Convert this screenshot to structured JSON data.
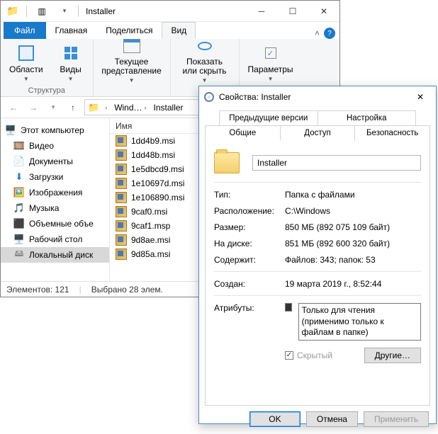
{
  "explorer": {
    "title": "Installer",
    "filetab": "Файл",
    "tabs": [
      "Главная",
      "Поделиться",
      "Вид"
    ],
    "active_tab": 2,
    "ribbon": {
      "areas": "Области",
      "views": "Виды",
      "current_view": "Текущее представление",
      "show_hide": "Показать или скрыть",
      "params": "Параметры",
      "group_structure": "Структура"
    },
    "breadcrumb": [
      "Wind…",
      "Installer"
    ],
    "sidebar": [
      {
        "label": "Этот компьютер",
        "icon": "pc",
        "root": true
      },
      {
        "label": "Видео",
        "icon": "vid"
      },
      {
        "label": "Документы",
        "icon": "doc"
      },
      {
        "label": "Загрузки",
        "icon": "dl"
      },
      {
        "label": "Изображения",
        "icon": "img"
      },
      {
        "label": "Музыка",
        "icon": "mus"
      },
      {
        "label": "Объемные объе",
        "icon": "3d"
      },
      {
        "label": "Рабочий стол",
        "icon": "desk"
      },
      {
        "label": "Локальный диск",
        "icon": "disk",
        "sel": true
      }
    ],
    "list_header": "Имя",
    "files": [
      "1dd4b9.msi",
      "1dd48b.msi",
      "1e5dbcd9.msi",
      "1e10697d.msi",
      "1e106890.msi",
      "9caf0.msi",
      "9caf1.msp",
      "9d8ae.msi",
      "9d85a.msi"
    ],
    "status_elements": "Элементов: 121",
    "status_selected": "Выбрано 28 элем."
  },
  "props": {
    "title": "Свойства: Installer",
    "tabs_top": [
      "Предыдущие версии",
      "Настройка"
    ],
    "tabs_bottom": [
      "Общие",
      "Доступ",
      "Безопасность"
    ],
    "active_tab": "Общие",
    "name": "Installer",
    "rows": {
      "type_k": "Тип:",
      "type_v": "Папка с файлами",
      "loc_k": "Расположение:",
      "loc_v": "C:\\Windows",
      "size_k": "Размер:",
      "size_v": "850 МБ (892 075 109 байт)",
      "disk_k": "На диске:",
      "disk_v": "851 МБ (892 600 320 байт)",
      "cont_k": "Содержит:",
      "cont_v": "Файлов: 343; папок: 53",
      "created_k": "Создан:",
      "created_v": "19 марта 2019 г., 8:52:44",
      "attr_k": "Атрибуты:"
    },
    "readonly_line1": "Только для чтения",
    "readonly_line2": "(применимо только к файлам в папке)",
    "hidden": "Скрытый",
    "other_btn": "Другие…",
    "ok": "OK",
    "cancel": "Отмена",
    "apply": "Применить"
  }
}
